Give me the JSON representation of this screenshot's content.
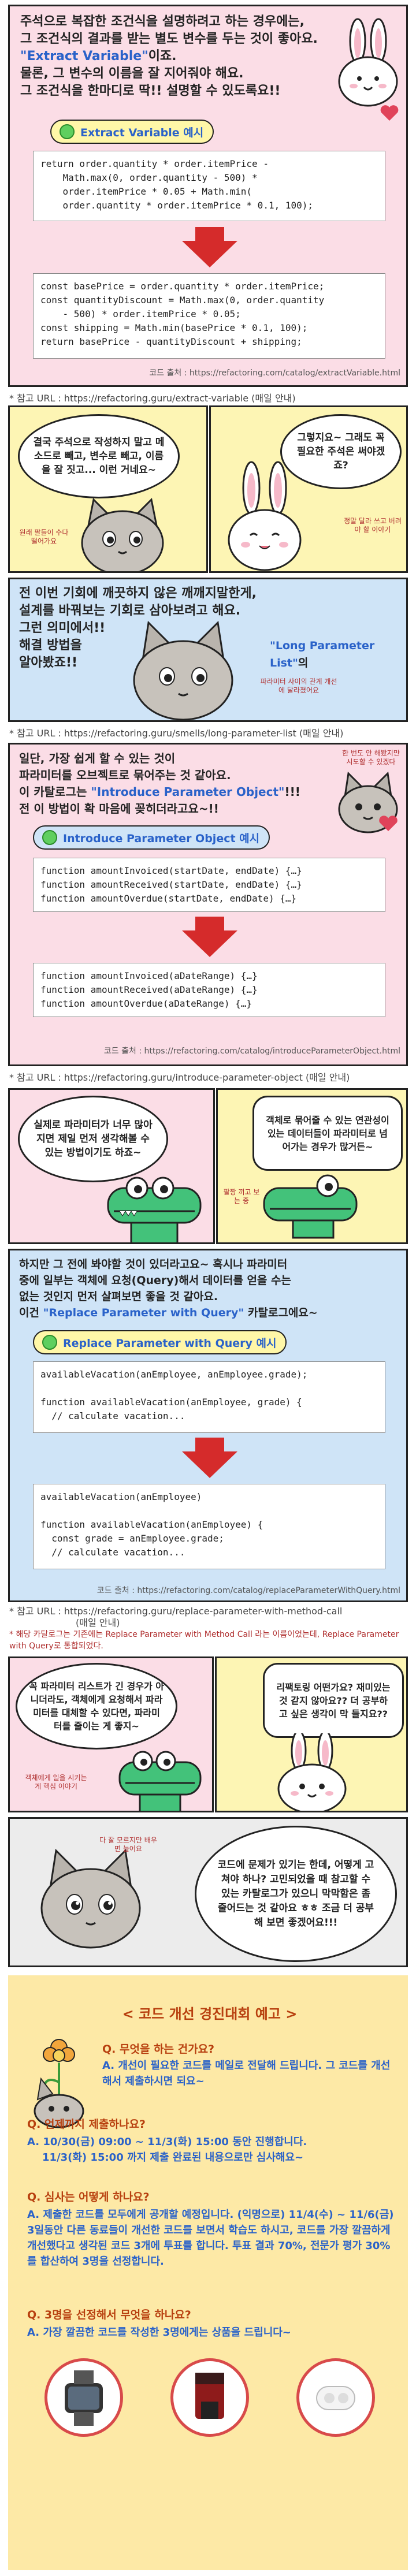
{
  "p1": {
    "line1": "주석으로 복잡한 조건식을 설명하려고 하는 경우에는,",
    "line2": "그 조건식의 결과를 받는 별도 변수를 두는 것이 좋아요.",
    "kw": "\"Extract Variable\"",
    "line3_suffix": "이죠.",
    "line4": "물론, 그 변수의 이름을 잘 지어줘야 해요.",
    "line5": "그 조건식을 한마디로 딱!! 설명할 수 있도록요!!",
    "tag": "Extract Variable 예시",
    "code_before": "return order.quantity * order.itemPrice -\n    Math.max(0, order.quantity - 500) *\n    order.itemPrice * 0.05 + Math.min(\n    order.quantity * order.itemPrice * 0.1, 100);",
    "code_after": "const basePrice = order.quantity * order.itemPrice;\nconst quantityDiscount = Math.max(0, order.quantity\n    - 500) * order.itemPrice * 0.05;\nconst shipping = Math.min(basePrice * 0.1, 100);\nreturn basePrice - quantityDiscount + shipping;",
    "source": "코드 출처 : https://refactoring.com/catalog/extractVariable.html"
  },
  "ref1": "* 참고 URL : https://refactoring.guru/extract-variable (매일 안내)",
  "p2": {
    "bubble_left": "결국 주석으로 작성하지 말고 메소드로 빼고, 변수로 빼고, 이름을 잘 짓고... 이런 거네요~",
    "note_left": "원래 팔들이 수다 떨어가요",
    "bubble_right": "그렇지요~ 그래도 꼭 필요한 주석은 써야겠죠?",
    "note_right": "정말 달라 쓰고 버려야 할 이야기"
  },
  "p3": {
    "line1": "전 이번 기회에 깨끗하지 않은 깨깨지말한게,",
    "line2": "설계를 바꿔보는 기회로 삼아보려고 해요.",
    "line3": "그런 의미에서!!",
    "kw": "\"Long Parameter List\"",
    "line3_suffix": "의",
    "line4": "해결 방법을",
    "line5": "알아봤죠!!",
    "note": "파라미터 사이의 관계 개선에 달라졌어요"
  },
  "ref2": "* 참고 URL : https://refactoring.guru/smells/long-parameter-list (매일 안내)",
  "p4": {
    "line1": "일단, 가장 쉽게 할 수 있는 것이",
    "line2": "파라미터를 오브젝트로 묶어주는 것 같아요.",
    "line3_prefix": "이 카탈로그는",
    "kw": "\"Introduce Parameter Object\"",
    "line3_suffix": "!!!",
    "line4": "전 이 방법이 확 마음에 꽂히더라고요~!!",
    "note": "한 번도 안 해봤지만 시도할 수 있겠다",
    "tag": "Introduce Parameter Object 예시",
    "code_before": "function amountInvoiced(startDate, endDate) {…}\nfunction amountReceived(startDate, endDate) {…}\nfunction amountOverdue(startDate, endDate) {…}",
    "code_after": "function amountInvoiced(aDateRange) {…}\nfunction amountReceived(aDateRange) {…}\nfunction amountOverdue(aDateRange) {…}",
    "source": "코드 출처 : https://refactoring.com/catalog/introduceParameterObject.html"
  },
  "ref3": "* 참고 URL : https://refactoring.guru/introduce-parameter-object (매일 안내)",
  "p5": {
    "bubble_left": "실제로 파라미터가 너무 많아지면 제일 먼저 생각해볼 수 있는 방법이기도 하죠~",
    "bubble_right": "객체로 묶어줄 수 있는 연관성이 있는 데이터들이 파라미터로 넘어가는 경우가 많거든~",
    "note_right": "팔짱 끼고 보는 중"
  },
  "p6": {
    "line1": "하지만 그 전에 봐야할 것이 있더라고요~ 혹시나 파라미터",
    "line2": "중에 일부는 객체에 요청(Query)해서 데이터를 얻을 수는",
    "line3": "없는 것인지 먼저 살펴보면 좋을 것 같아요.",
    "line4_prefix": "이건",
    "kw": "\"Replace Parameter with Query\"",
    "line4_suffix": "카탈로그에요~",
    "tag": "Replace Parameter with Query 예시",
    "code_before": "availableVacation(anEmployee, anEmployee.grade);\n\nfunction availableVacation(anEmployee, grade) {\n  // calculate vacation...",
    "code_after": "availableVacation(anEmployee)\n\nfunction availableVacation(anEmployee) {\n  const grade = anEmployee.grade;\n  // calculate vacation...",
    "source": "코드 출처 : https://refactoring.com/catalog/replaceParameterWithQuery.html"
  },
  "ref4": "* 참고 URL : https://refactoring.guru/replace-parameter-with-method-call",
  "ref4b": "(매일 안내)",
  "ref5": "* 해당 카탈로그는 기존에는 Replace Parameter with Method Call 라는 이름이었는데, Replace Parameter with Query로 통합되었다.",
  "p7": {
    "bubble_left": "꼭 파라미터 리스트가 긴 경우가 아니더라도, 객체에게 요청해서 파라미터를 대체할 수 있다면, 파라미터를 줄이는 게 좋지~",
    "note_left": "객체에게 일을 시키는 게 핵심 이야기",
    "bubble_right": "리팩토링 어떤가요? 재미있는 것 같지 않아요?? 더 공부하고 싶은 생각이 막 들지요??"
  },
  "p8": {
    "bubble": "코드에 문제가 있기는 한데, 어떻게 고쳐야 하나? 고민되었을 때 참고할 수 있는 카탈로그가 있으니 막막함은 좀 줄어드는 것 같아요 ㅎㅎ 조금 더 공부해 보면 좋겠어요!!!",
    "note": "다 잘 모르지만 배우면 늘어요"
  },
  "event": {
    "title": "< 코드 개선 경진대회 예고 >",
    "q1": "Q. 무엇을 하는 건가요?",
    "a1": "A. 개선이 필요한 코드를 메일로 전달해 드립니다. 그 코드를 개선해서 제출하시면 되요~",
    "q2": "Q. 언제까지 제출하나요?",
    "a2a": "A. 10/30(금) 09:00 ~ 11/3(화) 15:00 동안 진행합니다.",
    "a2b": "11/3(화) 15:00 까지 제출 완료된 내용으로만 심사해요~",
    "q3": "Q. 심사는 어떻게 하나요?",
    "a3": "A. 제출한 코드를 모두에게 공개할 예정입니다. (익명으로) 11/4(수) ~ 11/6(금) 3일동안 다른 동료들이 개선한 코드를 보면서 학습도 하시고, 코드를 가장 깔끔하게 개선했다고 생각된 코드 3개에 투표를 합니다. 투표 결과 70%, 전문가 평가 30%를 합산하여 3명을 선정합니다.",
    "q4": "Q. 3명을 선정해서 무엇을 하나요?",
    "a4": "A. 가장 깔끔한 코드를 작성한 3명에게는 상품을 드립니다~"
  },
  "colors": {
    "pink": "#fbdde6",
    "yellow": "#fdf5b4",
    "blue": "#cfe4f7",
    "accent": "#2a62c9",
    "arrow": "#d52b2b",
    "prize": "#b8400f"
  }
}
